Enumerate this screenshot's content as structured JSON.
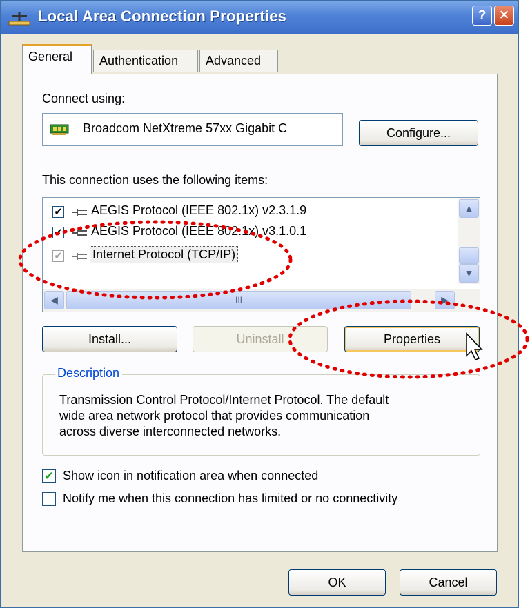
{
  "window": {
    "title": "Local Area Connection Properties",
    "help_label": "?",
    "close_label": "✕"
  },
  "tabs": [
    {
      "label": "General",
      "active": true
    },
    {
      "label": "Authentication",
      "active": false
    },
    {
      "label": "Advanced",
      "active": false
    }
  ],
  "connect_using": {
    "label": "Connect using:",
    "adapter": "Broadcom NetXtreme 57xx Gigabit C",
    "configure_label": "Configure..."
  },
  "items_section": {
    "label": "This connection uses the following items:",
    "items": [
      {
        "label": "AEGIS Protocol (IEEE 802.1x) v2.3.1.9",
        "checked": true
      },
      {
        "label": "AEGIS Protocol (IEEE 802.1x) v3.1.0.1",
        "checked": true
      },
      {
        "label": "Internet Protocol (TCP/IP)",
        "checked": true,
        "selected": true
      }
    ],
    "hscroll_thumb": "III"
  },
  "buttons": {
    "install": "Install...",
    "uninstall": "Uninstall",
    "properties": "Properties",
    "ok": "OK",
    "cancel": "Cancel"
  },
  "description": {
    "title": "Description",
    "lines": [
      "Transmission Control Protocol/Internet Protocol. The default",
      "wide area network protocol that provides communication",
      "across diverse interconnected networks."
    ]
  },
  "options": [
    {
      "label": "Show icon in notification area when connected",
      "checked": true
    },
    {
      "label": "Notify me when this connection has limited or no connectivity",
      "checked": false
    }
  ],
  "colors": {
    "annotation": "#e00000",
    "accent_blue": "#0046d5",
    "titlebar": "#3d6fca"
  }
}
